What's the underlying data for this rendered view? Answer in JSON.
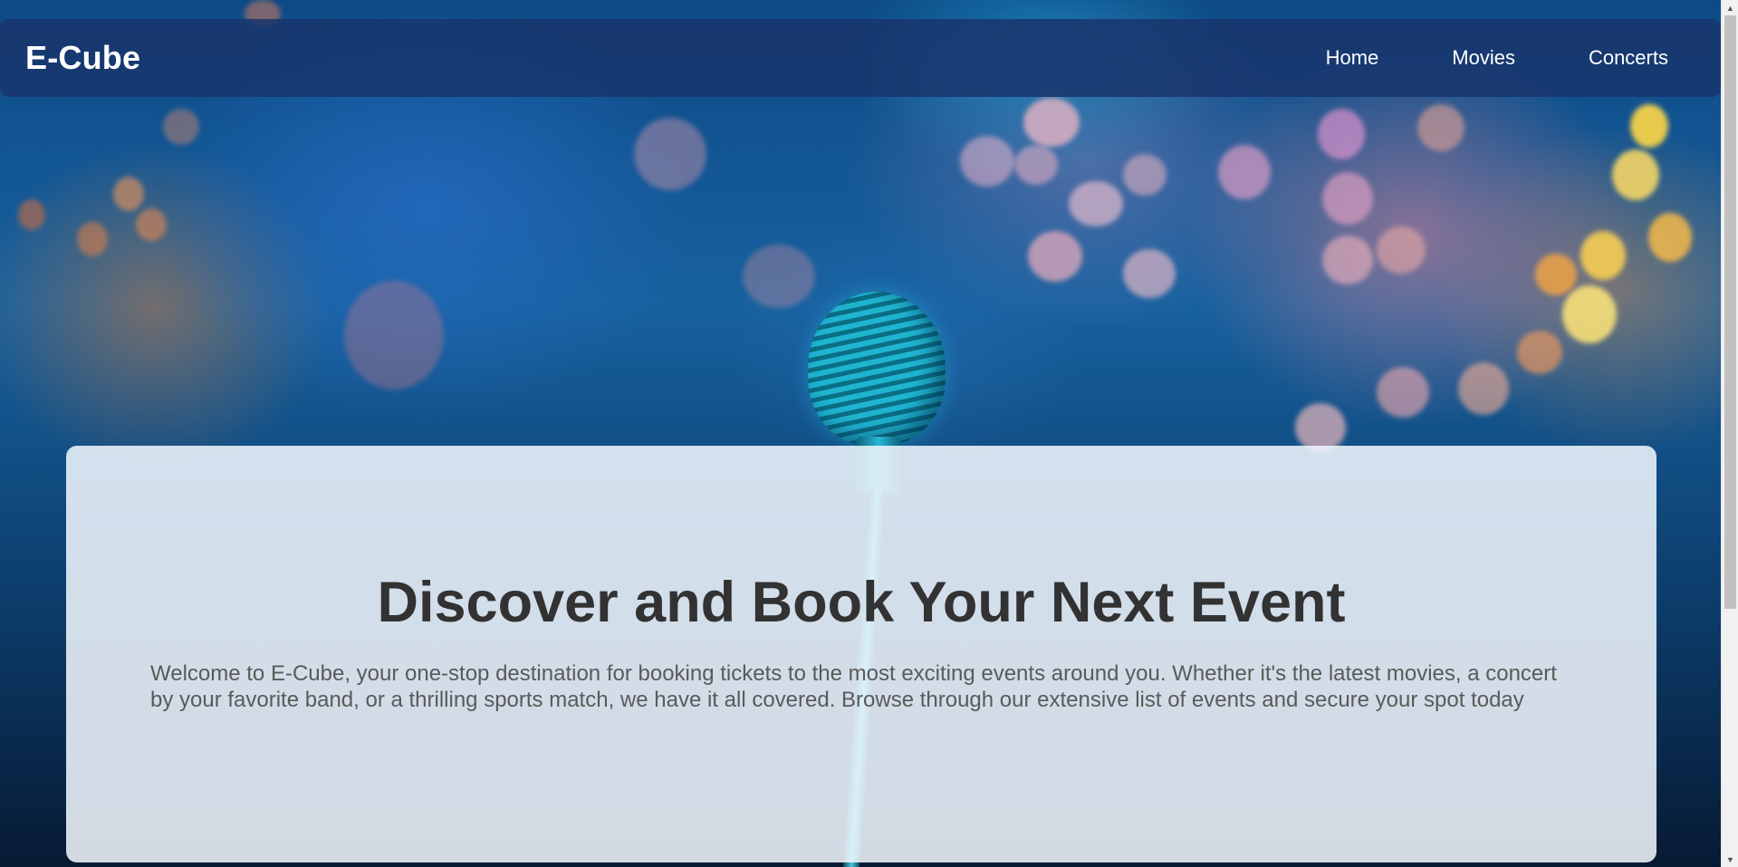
{
  "navbar": {
    "logo": "E-Cube",
    "links": [
      "Home",
      "Movies",
      "Concerts"
    ]
  },
  "hero": {
    "title": "Discover and Book Your Next Event",
    "description": "Welcome to E-Cube, your one-stop destination for booking tickets to the most exciting events around you. Whether it's the latest movies, a concert by your favorite band, or a thrilling sports match, we have it all covered. Browse through our extensive list of events and secure your spot today"
  },
  "background": {
    "image": "blurred concert stage with vintage microphone",
    "accent_blue": "#1a4f8f",
    "nav_color": "#18366c"
  },
  "scrollbar": {
    "up_icon": "up-arrow-icon",
    "down_icon": "down-arrow-icon"
  }
}
